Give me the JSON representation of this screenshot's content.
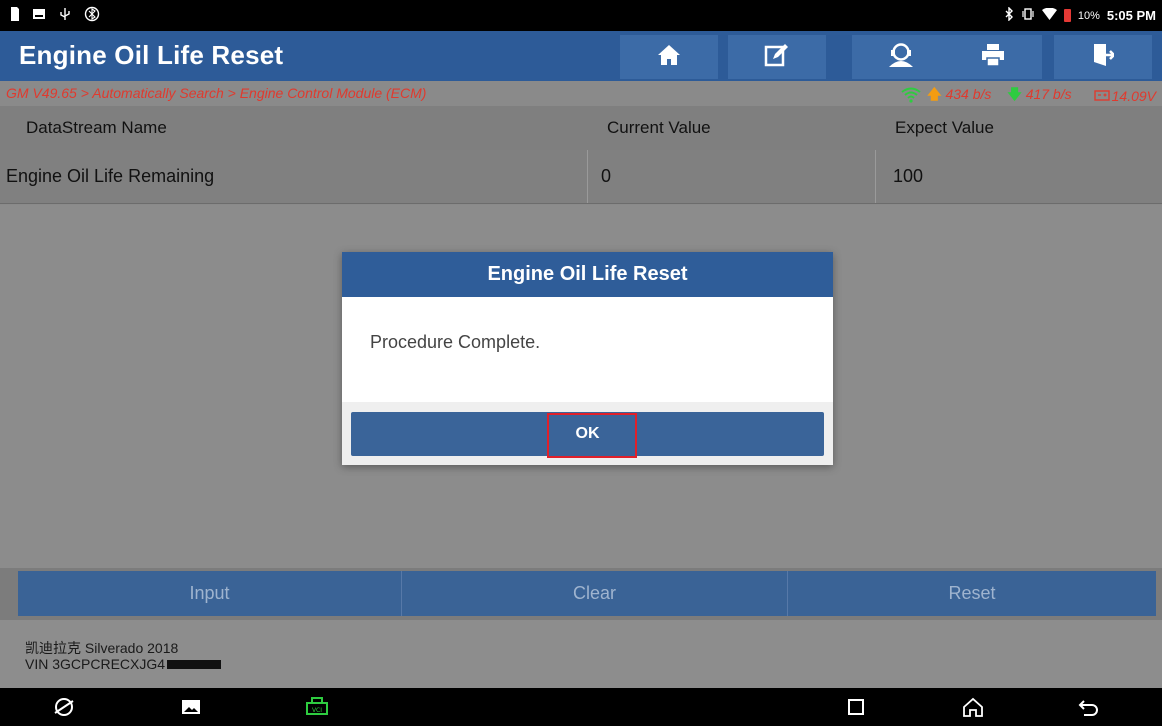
{
  "status_bar": {
    "battery_percent": "10%",
    "time": "5:05 PM",
    "battery_color": "#e53935"
  },
  "header": {
    "title": "Engine Oil Life Reset",
    "buttons": [
      "home-icon",
      "edit-report-icon",
      "user-support-icon",
      "print-icon",
      "exit-icon"
    ],
    "color": "#2d5b98"
  },
  "breadcrumb": {
    "path": "GM V49.65 > Automatically Search > Engine Control Module (ECM)",
    "upload_rate": "434 b/s",
    "download_rate": "417 b/s",
    "voltage": "14.09V",
    "color": "#e03a2e"
  },
  "table": {
    "columns": [
      "DataStream Name",
      "Current Value",
      "Expect Value"
    ],
    "rows": [
      {
        "name": "Engine Oil Life Remaining",
        "current": "0",
        "expected": "100"
      }
    ]
  },
  "dialog": {
    "title": "Engine Oil Life Reset",
    "message": "Procedure Complete.",
    "ok_label": "OK"
  },
  "actions": {
    "input_label": "Input",
    "clear_label": "Clear",
    "reset_label": "Reset"
  },
  "vehicle": {
    "model": "凯迪拉克 Silverado 2018",
    "vin_prefix": "VIN 3GCPCRECXJG4"
  },
  "navbar": {
    "icons": [
      "browser-icon",
      "gallery-icon",
      "vci-icon",
      "recents-icon",
      "home-nav-icon",
      "back-icon"
    ]
  }
}
